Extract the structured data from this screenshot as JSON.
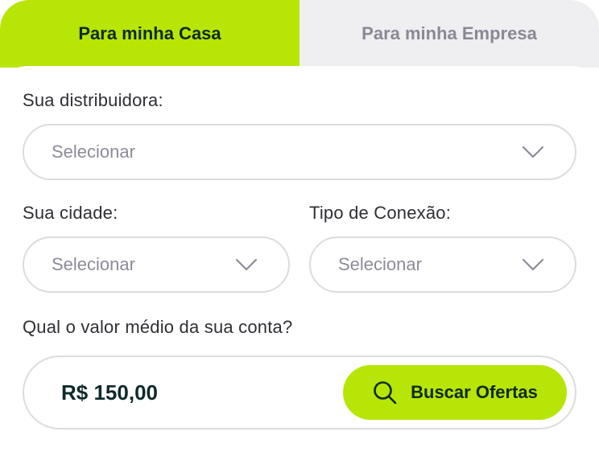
{
  "tabs": {
    "home_label": "Para minha Casa",
    "business_label": "Para minha Empresa",
    "active": "home"
  },
  "form": {
    "distributor": {
      "label": "Sua distribuidora:",
      "placeholder": "Selecionar"
    },
    "city": {
      "label": "Sua cidade:",
      "placeholder": "Selecionar"
    },
    "connection_type": {
      "label": "Tipo de Conexão:",
      "placeholder": "Selecionar"
    },
    "bill_value": {
      "label": "Qual o valor médio da sua conta?",
      "value": "R$ 150,00"
    },
    "search_button_label": "Buscar Ofertas"
  },
  "colors": {
    "accent": "#b7e505",
    "text_dark": "#0e2a2a",
    "inactive_tab_bg": "#efeff2",
    "placeholder": "#8d8b98",
    "border": "#dcdce0"
  },
  "icons": {
    "select_chevron": "chevron-down-icon",
    "search": "search-icon"
  }
}
